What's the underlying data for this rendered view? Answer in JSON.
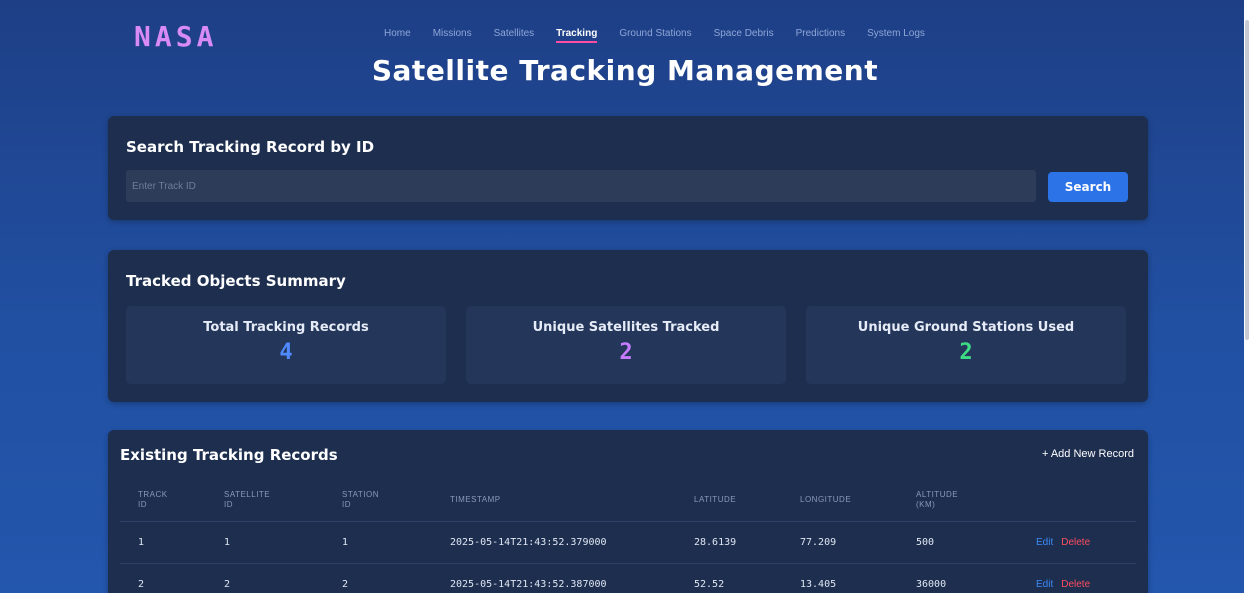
{
  "header": {
    "logo": "NASA",
    "nav": [
      "Home",
      "Missions",
      "Satellites",
      "Tracking",
      "Ground Stations",
      "Space Debris",
      "Predictions",
      "System Logs"
    ],
    "active_nav": "Tracking",
    "page_title": "Satellite Tracking Management"
  },
  "search": {
    "title": "Search Tracking Record by ID",
    "placeholder": "Enter Track ID",
    "button_label": "Search"
  },
  "summary": {
    "title": "Tracked Objects Summary",
    "stats": [
      {
        "label": "Total Tracking Records",
        "value": "4",
        "color": "#4f8bff"
      },
      {
        "label": "Unique Satellites Tracked",
        "value": "2",
        "color": "#c57cff"
      },
      {
        "label": "Unique Ground Stations Used",
        "value": "2",
        "color": "#3ddc84"
      }
    ]
  },
  "records": {
    "title": "Existing Tracking Records",
    "add_label": "+ Add New Record",
    "columns": [
      "TRACK\nID",
      "SATELLITE\nID",
      "STATION\nID",
      "TIMESTAMP",
      "LATITUDE",
      "LONGITUDE",
      "ALTITUDE\n(KM)",
      ""
    ],
    "rows": [
      {
        "track_id": "1",
        "satellite_id": "1",
        "station_id": "1",
        "timestamp": "2025-05-14T21:43:52.379000",
        "latitude": "28.6139",
        "longitude": "77.209",
        "altitude": "500"
      },
      {
        "track_id": "2",
        "satellite_id": "2",
        "station_id": "2",
        "timestamp": "2025-05-14T21:43:52.387000",
        "latitude": "52.52",
        "longitude": "13.405",
        "altitude": "36000"
      }
    ],
    "edit_label": "Edit",
    "delete_label": "Delete"
  },
  "colors": {
    "logo": "#d88af5",
    "accent": "#2c73e8",
    "active_underline": "#ff4da6",
    "card_bg": "#1d2e4f",
    "delete": "#ff4d5e"
  }
}
